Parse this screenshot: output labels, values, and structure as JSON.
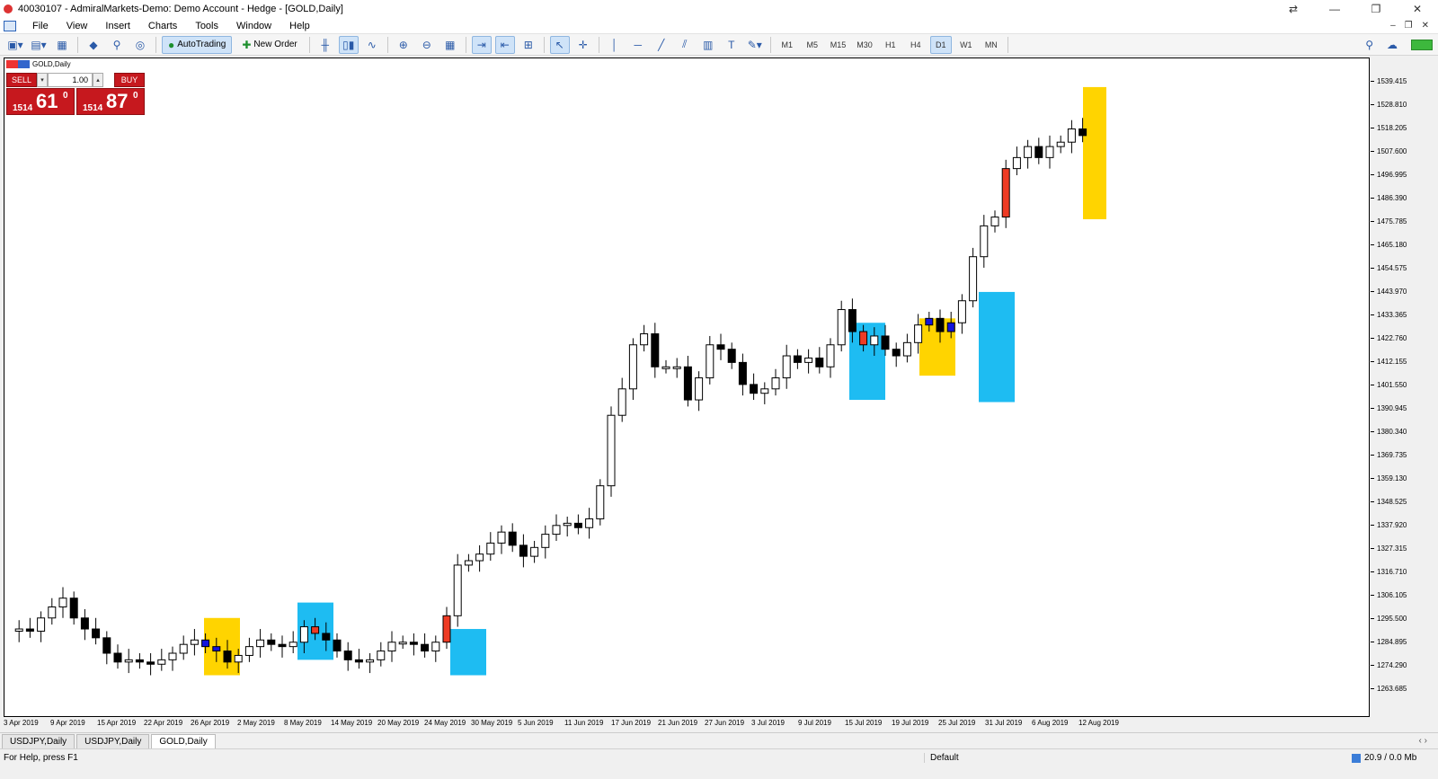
{
  "window": {
    "title": "40030107 - AdmiralMarkets-Demo: Demo Account - Hedge - [GOLD,Daily]"
  },
  "menu": [
    "File",
    "View",
    "Insert",
    "Charts",
    "Tools",
    "Window",
    "Help"
  ],
  "toolbar": {
    "auto_trading": "AutoTrading",
    "new_order": "New Order",
    "timeframes": [
      "M1",
      "M5",
      "M15",
      "M30",
      "H1",
      "H4",
      "D1",
      "W1",
      "MN"
    ],
    "active_timeframe": "D1"
  },
  "chart": {
    "label": "GOLD,Daily",
    "trade_panel": {
      "sell": "SELL",
      "buy": "BUY",
      "volume": "1.00",
      "bid_big": "1514",
      "bid_pips": "61",
      "bid_sup": "0",
      "ask_big": "1514",
      "ask_pips": "87",
      "ask_sup": "0"
    },
    "price_labels": [
      "1539.415",
      "1528.810",
      "1518.205",
      "1507.600",
      "1496.995",
      "1486.390",
      "1475.785",
      "1465.180",
      "1454.575",
      "1443.970",
      "1433.365",
      "1422.760",
      "1412.155",
      "1401.550",
      "1390.945",
      "1380.340",
      "1369.735",
      "1359.130",
      "1348.525",
      "1337.920",
      "1327.315",
      "1316.710",
      "1306.105",
      "1295.500",
      "1284.895",
      "1274.290",
      "1263.685"
    ],
    "date_labels": [
      "3 Apr 2019",
      "9 Apr 2019",
      "15 Apr 2019",
      "22 Apr 2019",
      "26 Apr 2019",
      "2 May 2019",
      "8 May 2019",
      "14 May 2019",
      "20 May 2019",
      "24 May 2019",
      "30 May 2019",
      "5 Jun 2019",
      "11 Jun 2019",
      "17 Jun 2019",
      "21 Jun 2019",
      "27 Jun 2019",
      "3 Jul 2019",
      "9 Jul 2019",
      "15 Jul 2019",
      "19 Jul 2019",
      "25 Jul 2019",
      "31 Jul 2019",
      "6 Aug 2019",
      "12 Aug 2019"
    ],
    "colors": {
      "highlight_yellow": "#ffd400",
      "highlight_cyan": "#1ebcf2",
      "candle_red": "#ee3b24",
      "candle_blue": "#1414dc",
      "bull": "#ffffff",
      "bear": "#000000"
    }
  },
  "tabs": [
    "USDJPY,Daily",
    "USDJPY,Daily",
    "GOLD,Daily"
  ],
  "active_tab": 2,
  "status": {
    "help": "For Help, press F1",
    "profile": "Default",
    "traffic": "20.9 / 0.0 Mb"
  }
}
